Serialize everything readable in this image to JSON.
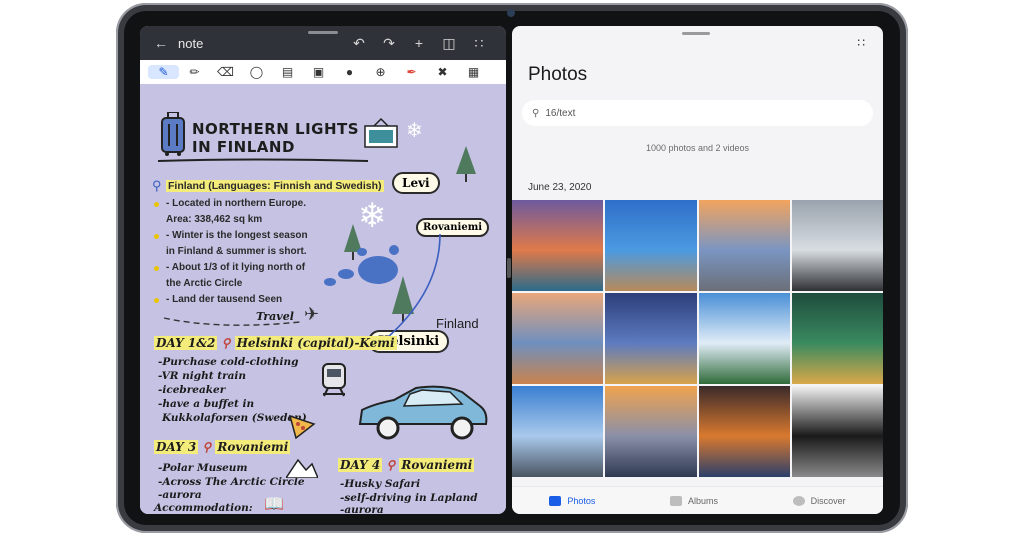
{
  "note": {
    "title": "note",
    "icons": [
      "back-arrow-icon",
      "undo-icon",
      "redo-icon",
      "add-icon",
      "layout-icon",
      "more-icon"
    ],
    "tools": [
      "pen-icon",
      "marker-icon",
      "eraser-icon",
      "lasso-icon",
      "text-icon",
      "image-icon",
      "shape-icon",
      "zoom-icon",
      "highlighter-icon",
      "pin-icon",
      "texture-icon"
    ],
    "heading_line1": "NORTHERN LIGHTS",
    "heading_line2": "IN FINLAND",
    "languages": "Finland (Languages: Finnish and Swedish)",
    "bullets": [
      "- Located in northern Europe.",
      "Area: 338,462 sq km",
      "- Winter is the longest season",
      "in Finland &  summer is short.",
      "- About 1/3 of it lying north of",
      "the Arctic Circle",
      "- Land der tausend Seen"
    ],
    "travel": "Travel",
    "finland_label": "Finland",
    "bubbles": {
      "levi": "Levi",
      "rovaniemi": "Rovaniemi",
      "helsinki": "Helsinki"
    },
    "day12": "DAY 1&2",
    "day12_place": "Helsinki (capital)-Kemi",
    "day12_items": [
      "-Purchase cold-clothing",
      "-VR night train",
      "-icebreaker",
      "-have a buffet in",
      "Kukkolaforsen (Sweden)"
    ],
    "day3": "DAY 3",
    "day3_place": "Rovaniemi",
    "day3_items": [
      "-Polar Museum",
      "-Across The Arctic Circle",
      "-aurora",
      "Accommodation:"
    ],
    "day4": "DAY 4",
    "day4_place": "Rovaniemi",
    "day4_items": [
      "-Husky Safari",
      "-self-driving in Lapland",
      "-aurora"
    ]
  },
  "photos": {
    "title": "Photos",
    "search_value": "16/text",
    "count": "1000 photos and 2 videos",
    "date": "June 23, 2020",
    "tabs": [
      {
        "label": "Photos",
        "active": true
      },
      {
        "label": "Albums",
        "active": false
      },
      {
        "label": "Discover",
        "active": false
      }
    ],
    "thumbnails": [
      {
        "name": "photo-sunset-rocks-sea",
        "colors": [
          "#6d5a9e",
          "#e07a4a",
          "#2b6b8a"
        ]
      },
      {
        "name": "photo-church-blue-sky",
        "colors": [
          "#2f6fc9",
          "#4b9ae0",
          "#b88a5a"
        ]
      },
      {
        "name": "photo-road-sunset",
        "colors": [
          "#f2a45e",
          "#7a95c2",
          "#6b6f78"
        ]
      },
      {
        "name": "photo-gray-coast-waves",
        "colors": [
          "#9aa3ad",
          "#d8dde2",
          "#2e3034"
        ]
      },
      {
        "name": "photo-sea-stacks-sunset",
        "colors": [
          "#e8a77a",
          "#6f8fbf",
          "#c9834c"
        ]
      },
      {
        "name": "photo-coastal-town-night",
        "colors": [
          "#2b3f7a",
          "#5d7bc0",
          "#d8a24a"
        ]
      },
      {
        "name": "photo-lake-town-mountains",
        "colors": [
          "#4a8fd6",
          "#e0ecf7",
          "#2f6b3a"
        ]
      },
      {
        "name": "photo-abstract-green-gold",
        "colors": [
          "#1e4c3e",
          "#3a8a5f",
          "#d9a84a"
        ]
      },
      {
        "name": "photo-cliff-blue-sea",
        "colors": [
          "#3b7fd1",
          "#a9c9ec",
          "#4a5462"
        ]
      },
      {
        "name": "photo-beach-sunset-rocks",
        "colors": [
          "#f0a34e",
          "#8a8fa8",
          "#2f3a52"
        ]
      },
      {
        "name": "photo-city-skyscrapers-night",
        "colors": [
          "#3a2a2a",
          "#d9792f",
          "#2c3f6b"
        ]
      },
      {
        "name": "photo-bw-architecture",
        "colors": [
          "#f2f2f2",
          "#1a1a1a",
          "#8a8a8a"
        ]
      }
    ]
  }
}
